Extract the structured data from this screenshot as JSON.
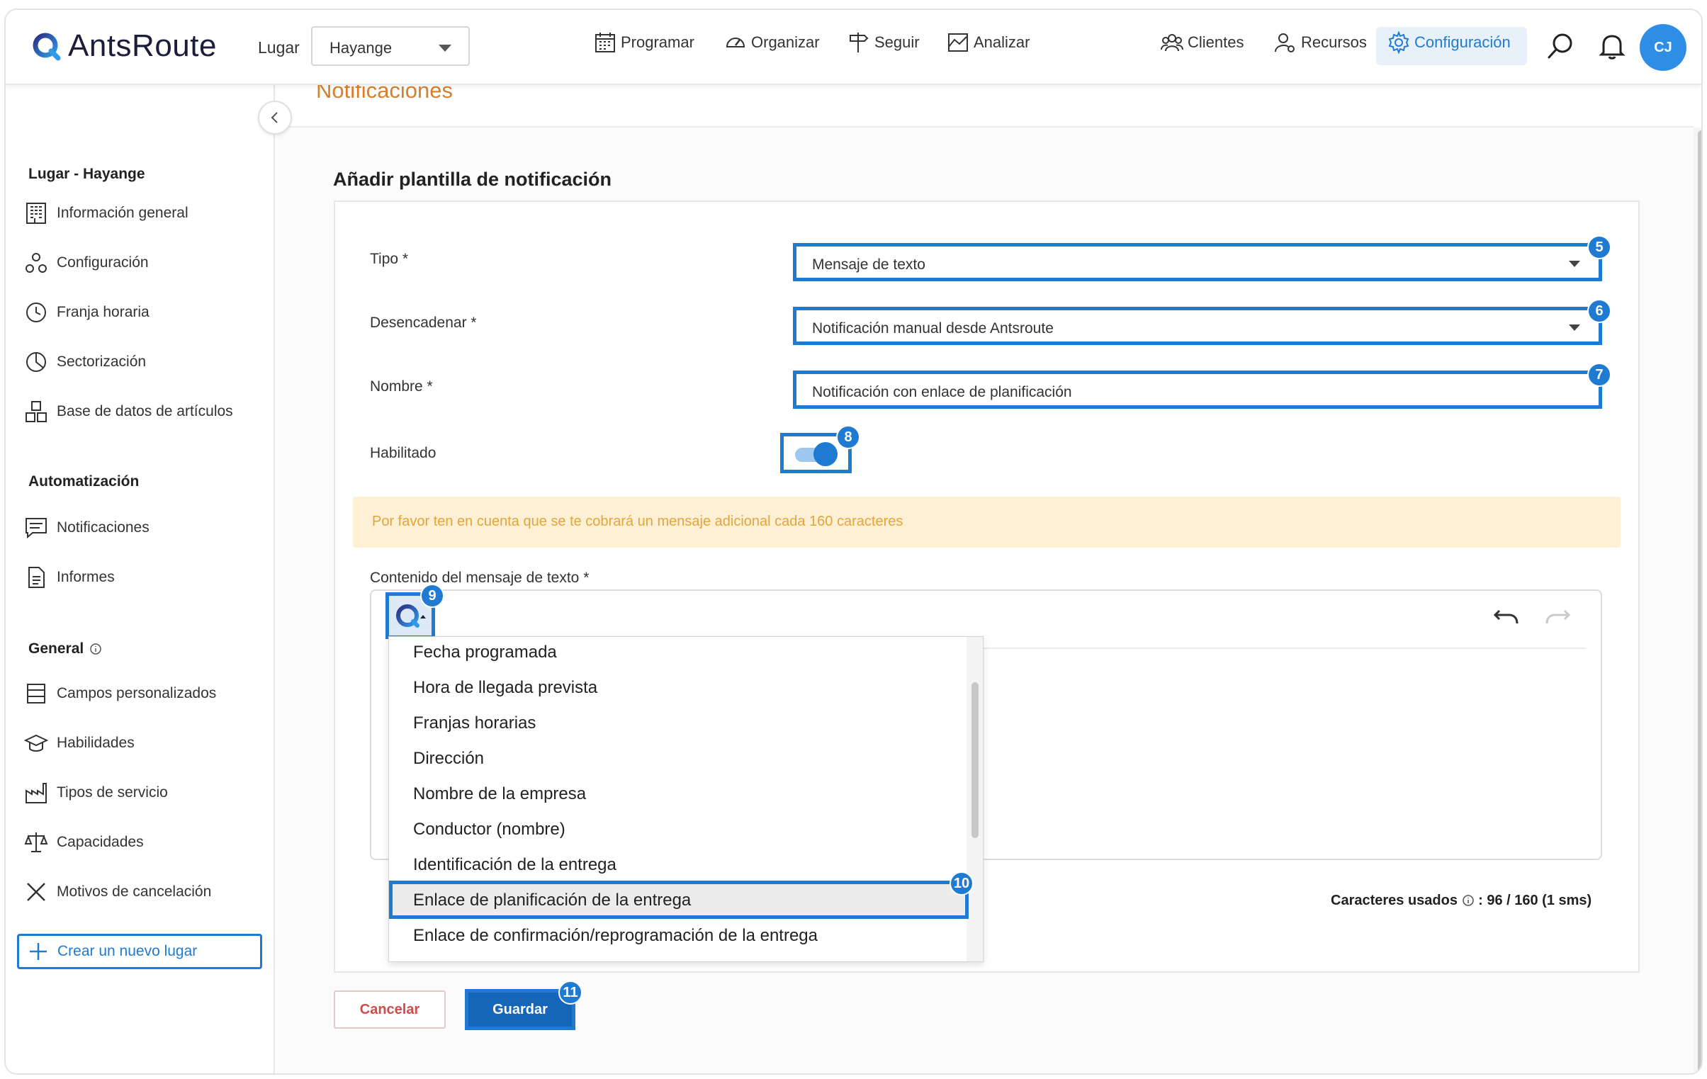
{
  "app": {
    "logo_text": "AntsRoute",
    "lugar_label": "Lugar",
    "lugar_value": "Hayange",
    "nav": {
      "programar": "Programar",
      "organizar": "Organizar",
      "seguir": "Seguir",
      "analizar": "Analizar",
      "clientes": "Clientes",
      "recursos": "Recursos",
      "configuracion": "Configuración"
    },
    "avatar_initials": "CJ",
    "accent": "#1f7bd1"
  },
  "sidebar": {
    "section_lugar": "Lugar - Hayange",
    "lugar_items": [
      "Información general",
      "Configuración",
      "Franja horaria",
      "Sectorización",
      "Base de datos de artículos"
    ],
    "section_auto": "Automatización",
    "auto_items": [
      "Notificaciones",
      "Informes"
    ],
    "section_general": "General",
    "general_items": [
      "Campos personalizados",
      "Habilidades",
      "Tipos de servicio",
      "Capacidades",
      "Motivos de cancelación"
    ],
    "create_label": "Crear un nuevo lugar"
  },
  "main": {
    "breadcrumb_title": "Notificaciones",
    "page_title": "Añadir plantilla de notificación",
    "tipo_label": "Tipo *",
    "tipo_value": "Mensaje de texto",
    "desencadenar_label": "Desencadenar *",
    "desencadenar_value": "Notificación manual desde Antsroute",
    "nombre_label": "Nombre *",
    "nombre_value": "Notificación con enlace de planificación",
    "habilitado_label": "Habilitado",
    "habilitado_on": true,
    "notice": "Por favor ten en cuenta que se te cobrará un mensaje adicional cada 160 caracteres",
    "contenido_label": "Contenido del mensaje de texto *",
    "dropdown_items": [
      "Fecha programada",
      "Hora de llegada prevista",
      "Franjas horarias",
      "Dirección",
      "Nombre de la empresa",
      "Conductor (nombre)",
      "Identificación de la entrega",
      "Enlace de planificación de la entrega",
      "Enlace de confirmación/reprogramación de la entrega"
    ],
    "selected_item": "Enlace de planificación de la entrega",
    "chars_label": "Caracteres usados",
    "chars_value": ": 96 / 160 (1 sms)",
    "cancel_label": "Cancelar",
    "save_label": "Guardar"
  },
  "badges": [
    "5",
    "6",
    "7",
    "8",
    "9",
    "10",
    "11"
  ]
}
